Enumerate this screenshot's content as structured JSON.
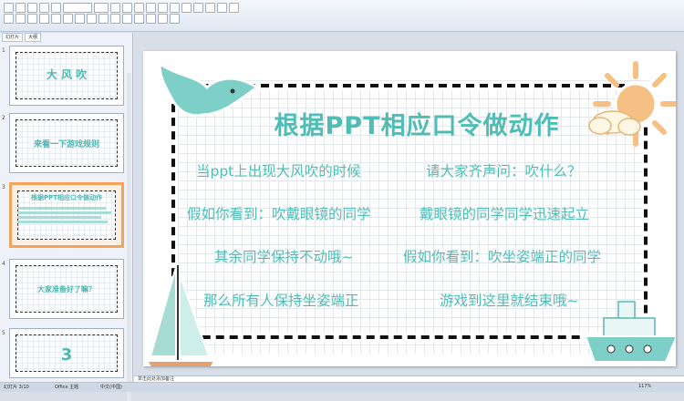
{
  "ribbon": {
    "groups": [
      "clipboard",
      "font",
      "paragraph",
      "drawing"
    ]
  },
  "panel": {
    "tabs": [
      "幻灯片",
      "大纲"
    ],
    "thumbs": [
      {
        "num": "1",
        "title": "大 风 吹"
      },
      {
        "num": "2",
        "title": "来看一下游戏规则"
      },
      {
        "num": "3",
        "title": "根据PPT相应口令做动作"
      },
      {
        "num": "4",
        "title": "大家准备好了嘛？"
      },
      {
        "num": "5",
        "title": "3"
      }
    ]
  },
  "slide": {
    "title": "根据PPT相应口令做动作",
    "lines": [
      "当ppt上出现大风吹的时候",
      "请大家齐声问：吹什么？",
      "假如你看到：吹戴眼镜的同学",
      "戴眼镜的同学同学迅速起立",
      "其余同学保持不动哦~",
      "假如你看到：吹坐姿端正的同学",
      "那么所有人保持坐姿端正",
      "游戏到这里就结束哦~"
    ]
  },
  "notes": {
    "placeholder": "单击此处添加备注"
  },
  "status": {
    "left": "幻灯片 3/10",
    "theme": "Office 主题",
    "lang": "中文(中国)",
    "zoom": "117%"
  }
}
